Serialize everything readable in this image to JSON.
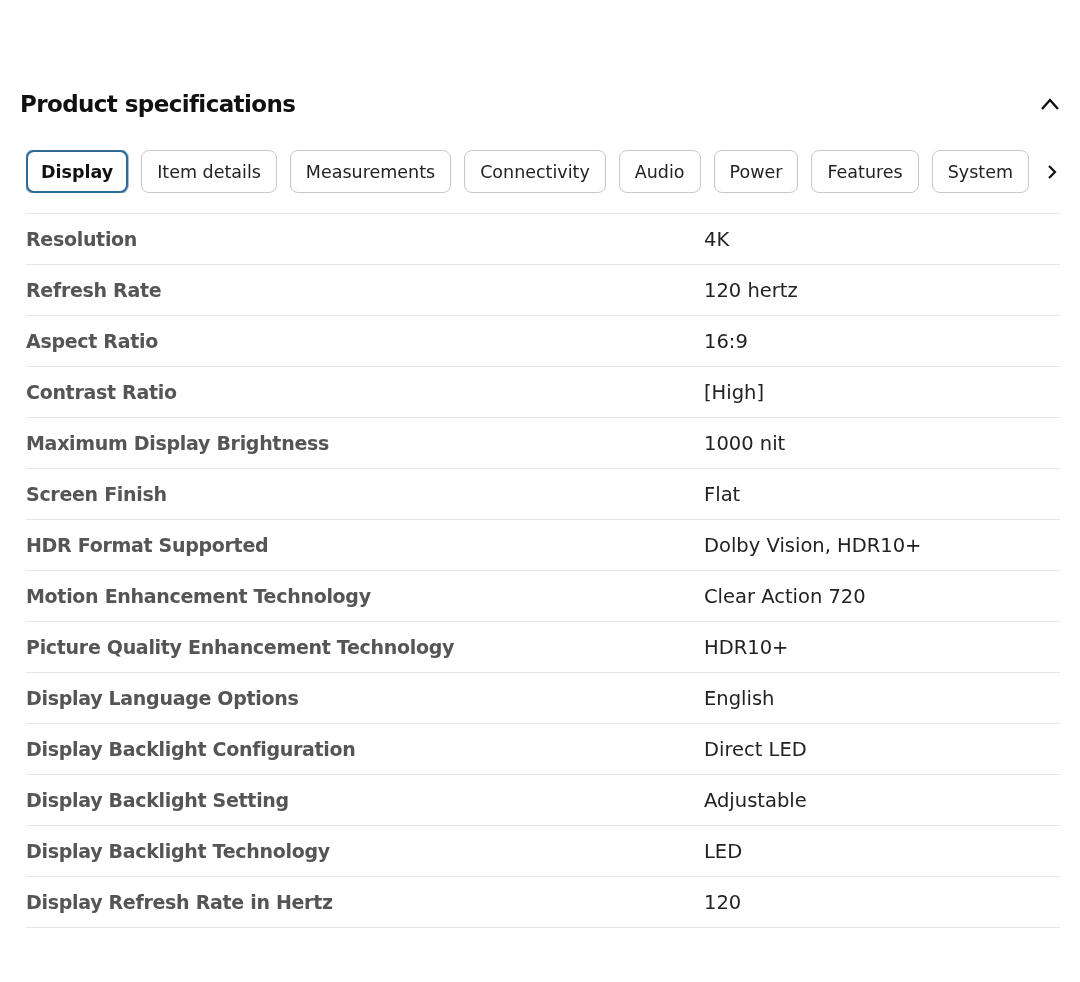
{
  "section": {
    "title": "Product specifications",
    "expanded": true
  },
  "tabs": [
    {
      "label": "Display",
      "selected": true
    },
    {
      "label": "Item details",
      "selected": false
    },
    {
      "label": "Measurements",
      "selected": false
    },
    {
      "label": "Connectivity",
      "selected": false
    },
    {
      "label": "Audio",
      "selected": false
    },
    {
      "label": "Power",
      "selected": false
    },
    {
      "label": "Features",
      "selected": false
    },
    {
      "label": "System",
      "selected": false
    }
  ],
  "specs": [
    {
      "name": "Resolution",
      "value": "4K"
    },
    {
      "name": "Refresh Rate",
      "value": "120 hertz"
    },
    {
      "name": "Aspect Ratio",
      "value": "16:9"
    },
    {
      "name": "Contrast Ratio",
      "value": "[High]"
    },
    {
      "name": "Maximum Display Brightness",
      "value": "1000 nit"
    },
    {
      "name": "Screen Finish",
      "value": "Flat"
    },
    {
      "name": "HDR Format Supported",
      "value": "Dolby Vision, HDR10+"
    },
    {
      "name": "Motion Enhancement Technology",
      "value": "Clear Action 720"
    },
    {
      "name": "Picture Quality Enhancement Technology",
      "value": "HDR10+"
    },
    {
      "name": "Display Language Options",
      "value": "English"
    },
    {
      "name": "Display Backlight Configuration",
      "value": "Direct LED"
    },
    {
      "name": "Display Backlight Setting",
      "value": "Adjustable"
    },
    {
      "name": "Display Backlight Technology",
      "value": "LED"
    },
    {
      "name": "Display Refresh Rate in Hertz",
      "value": "120"
    }
  ]
}
